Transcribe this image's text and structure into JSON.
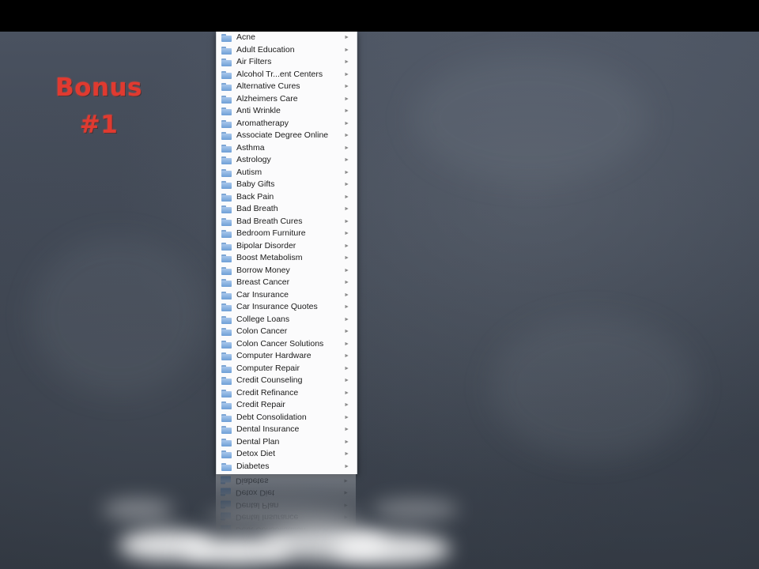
{
  "slide": {
    "bonus_line1": "Bonus",
    "bonus_line2": "#1"
  },
  "menu": {
    "submenu_indicator": "►",
    "items": [
      "Acne",
      "Adult Education",
      "Air Filters",
      "Alcohol Tr...ent Centers",
      "Alternative Cures",
      "Alzheimers Care",
      "Anti Wrinkle",
      "Aromatherapy",
      "Associate Degree Online",
      "Asthma",
      "Astrology",
      "Autism",
      "Baby Gifts",
      "Back Pain",
      "Bad Breath",
      "Bad Breath Cures",
      "Bedroom Furniture",
      "Bipolar Disorder",
      "Boost Metabolism",
      "Borrow Money",
      "Breast Cancer",
      "Car Insurance",
      "Car Insurance Quotes",
      "College Loans",
      "Colon Cancer",
      "Colon Cancer Solutions",
      "Computer Hardware",
      "Computer Repair",
      "Credit Counseling",
      "Credit Refinance",
      "Credit Repair",
      "Debt Consolidation",
      "Dental Insurance",
      "Dental Plan",
      "Detox Diet",
      "Diabetes"
    ]
  },
  "colors": {
    "bonus_text": "#e03a30",
    "folder_icon": "#6e9fd6",
    "menu_background": "#fbfbfc"
  }
}
